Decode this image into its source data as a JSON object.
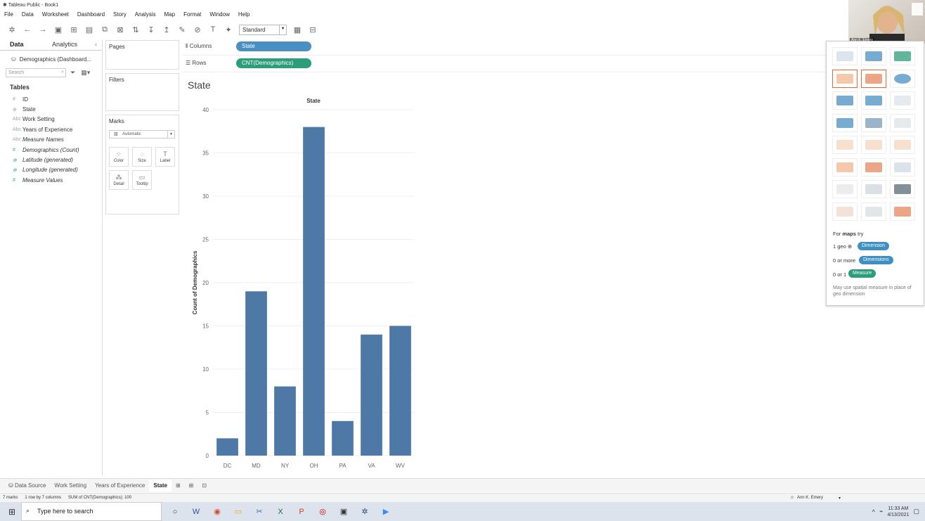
{
  "window": {
    "title": "Tableau Public - Book1"
  },
  "menu": [
    "File",
    "Data",
    "Worksheet",
    "Dashboard",
    "Story",
    "Analysis",
    "Map",
    "Format",
    "Window",
    "Help"
  ],
  "toolbar": {
    "fit_select": "Standard"
  },
  "left_pane": {
    "tabs": [
      "Data",
      "Analytics"
    ],
    "datasource": "Demographics (Dashboard...",
    "search_placeholder": "Search",
    "tables_heading": "Tables",
    "fields": [
      {
        "icon": "#",
        "name": "ID",
        "italic": false,
        "measure": false
      },
      {
        "icon": "⊕",
        "name": "State",
        "italic": false,
        "measure": false
      },
      {
        "icon": "Abc",
        "name": "Work Setting",
        "italic": false,
        "measure": false
      },
      {
        "icon": "Abc",
        "name": "Years of Experience",
        "italic": false,
        "measure": false
      },
      {
        "icon": "Abc",
        "name": "Measure Names",
        "italic": true,
        "measure": false
      },
      {
        "icon": "#",
        "name": "Demographics (Count)",
        "italic": true,
        "measure": true
      },
      {
        "icon": "⊕",
        "name": "Latitude (generated)",
        "italic": true,
        "measure": true
      },
      {
        "icon": "⊕",
        "name": "Longitude (generated)",
        "italic": true,
        "measure": true
      },
      {
        "icon": "#",
        "name": "Measure Values",
        "italic": true,
        "measure": true
      }
    ]
  },
  "cards": {
    "pages": "Pages",
    "filters": "Filters",
    "marks": "Marks",
    "mark_type": "Automatic",
    "mark_buttons": [
      "Color",
      "Size",
      "Label",
      "Detail",
      "Tooltip"
    ]
  },
  "shelves": {
    "columns_label": "Columns",
    "columns_pill": "State",
    "rows_label": "Rows",
    "rows_pill": "CNT(Demographics)"
  },
  "view": {
    "title": "State"
  },
  "chart_data": {
    "type": "bar",
    "title": "State",
    "xlabel": "",
    "ylabel": "Count of Demographics",
    "header": "State",
    "categories": [
      "DC",
      "MD",
      "NY",
      "OH",
      "PA",
      "VA",
      "WV"
    ],
    "values": [
      2,
      19,
      8,
      38,
      4,
      14,
      15
    ],
    "ylim": [
      0,
      40
    ],
    "yticks": [
      0,
      5,
      10,
      15,
      20,
      25,
      30,
      35,
      40
    ],
    "color": "#4e79a7",
    "grid": true
  },
  "show_me": {
    "for_text": "For",
    "maps_text": "maps",
    "try_text": "try",
    "rows": [
      {
        "label": "1 geo",
        "pill": "Dimension",
        "color": "#3f8fc1"
      },
      {
        "label": "0 or more",
        "pill": "Dimensions",
        "color": "#3f8fc1"
      },
      {
        "label": "0 or 1",
        "pill": "Measure",
        "color": "#2a9d7a"
      }
    ],
    "note": "May use spatial measure in place of geo dimension"
  },
  "sheet_tabs": [
    "Data Source",
    "Work Setting",
    "Years of Experience",
    "State"
  ],
  "status": {
    "marks": "7 marks",
    "dims": "1 row by 7 columns",
    "sum": "SUM of CNT(Demographics): 100",
    "user": "Ann K. Emery"
  },
  "taskbar": {
    "search_placeholder": "Type here to search",
    "time": "11:33 AM",
    "date": "4/13/2021"
  },
  "webcam": {
    "name": "Ann K. Emery"
  }
}
